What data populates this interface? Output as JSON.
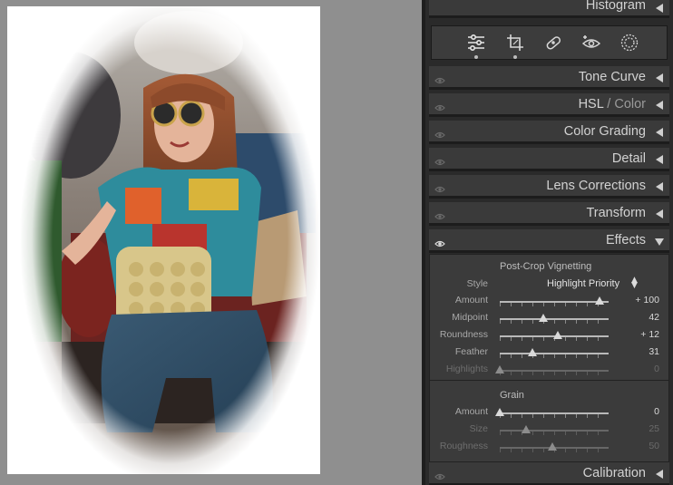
{
  "panel": {
    "histogram": "Histogram",
    "sections": {
      "tone_curve": "Tone Curve",
      "hsl_a": "HSL",
      "hsl_slash": " / ",
      "hsl_b": "Color",
      "color_grading": "Color Grading",
      "detail": "Detail",
      "lens_corrections": "Lens Corrections",
      "transform": "Transform",
      "effects": "Effects",
      "calibration": "Calibration"
    },
    "tools": [
      "edit-sliders-icon",
      "crop-icon",
      "healing-icon",
      "redeye-icon",
      "masking-icon"
    ]
  },
  "effects": {
    "vignette_title": "Post-Crop Vignetting",
    "style_label": "Style",
    "style_value": "Highlight Priority",
    "vignette_rows": [
      {
        "label": "Amount",
        "value": "+ 100",
        "fraction": 0.96,
        "dim": false
      },
      {
        "label": "Midpoint",
        "value": "42",
        "fraction": 0.42,
        "dim": false
      },
      {
        "label": "Roundness",
        "value": "+ 12",
        "fraction": 0.56,
        "dim": false
      },
      {
        "label": "Feather",
        "value": "31",
        "fraction": 0.31,
        "dim": false
      },
      {
        "label": "Highlights",
        "value": "0",
        "fraction": 0.0,
        "dim": true
      }
    ],
    "grain_title": "Grain",
    "grain_rows": [
      {
        "label": "Amount",
        "value": "0",
        "fraction": 0.0,
        "dim": false
      },
      {
        "label": "Size",
        "value": "25",
        "fraction": 0.25,
        "dim": true
      },
      {
        "label": "Roughness",
        "value": "50",
        "fraction": 0.5,
        "dim": true
      }
    ]
  },
  "colors": {
    "panel_bg": "#2a2a2a",
    "section_bg": "#3a3a3a",
    "canvas_bg": "#8f8f8f"
  }
}
